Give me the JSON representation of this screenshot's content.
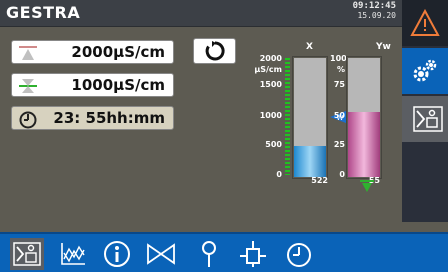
{
  "header": {
    "brand": "GESTRA",
    "time": "09:12:45",
    "date": "15.09.20"
  },
  "values": {
    "max_limit": "2000µS/cm",
    "min_limit": "1000µS/cm",
    "interval": "23: 55hh:mm"
  },
  "gauge_x": {
    "title": "X",
    "unit": "µS/cm",
    "ticks": [
      "2000",
      "1500",
      "1000",
      "500",
      "0"
    ],
    "value_label": "522",
    "level_fraction": 0.261,
    "setpoint_label": "W",
    "setpoint_fraction": 0.5
  },
  "gauge_y": {
    "title": "Yw",
    "unit": "%",
    "ticks": [
      "100",
      "75",
      "50",
      "25",
      "0"
    ],
    "value_label": "55",
    "level_fraction": 0.55
  },
  "colors": {
    "accent": "#0a63b8",
    "header": "#3c4046",
    "panel": "#5d5b52"
  },
  "icons": {
    "right_panel": [
      "warning-triangle-icon",
      "settings-gears-icon",
      "operation-menu-icon"
    ],
    "toolbar": [
      "operation-icon",
      "trend-icon",
      "info-icon",
      "valve-icon",
      "probe-icon",
      "sensor-icon",
      "timer-icon"
    ]
  }
}
